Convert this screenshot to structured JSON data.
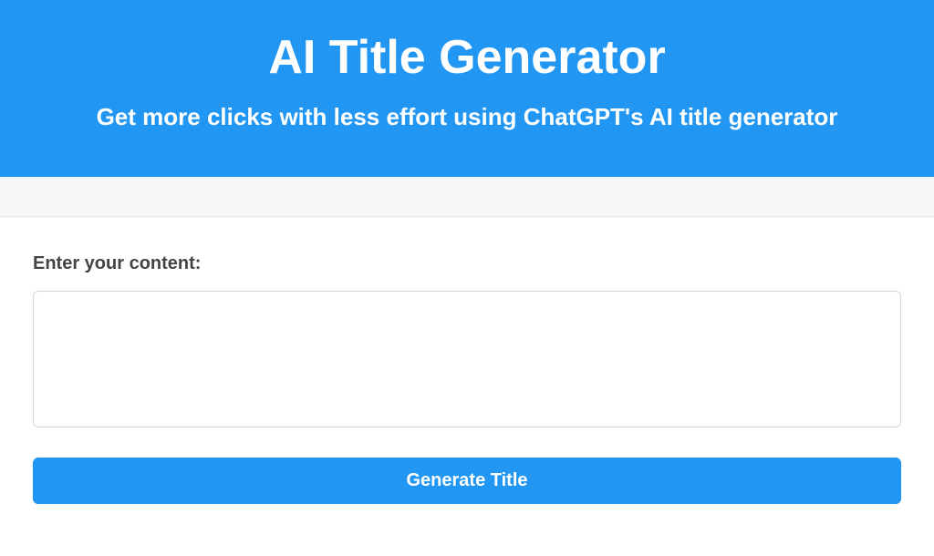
{
  "hero": {
    "title": "AI Title Generator",
    "subtitle": "Get more clicks with less effort using ChatGPT's AI title generator"
  },
  "form": {
    "label": "Enter your content:",
    "textarea_value": "",
    "button_label": "Generate Title"
  },
  "colors": {
    "primary": "#2196f3"
  }
}
